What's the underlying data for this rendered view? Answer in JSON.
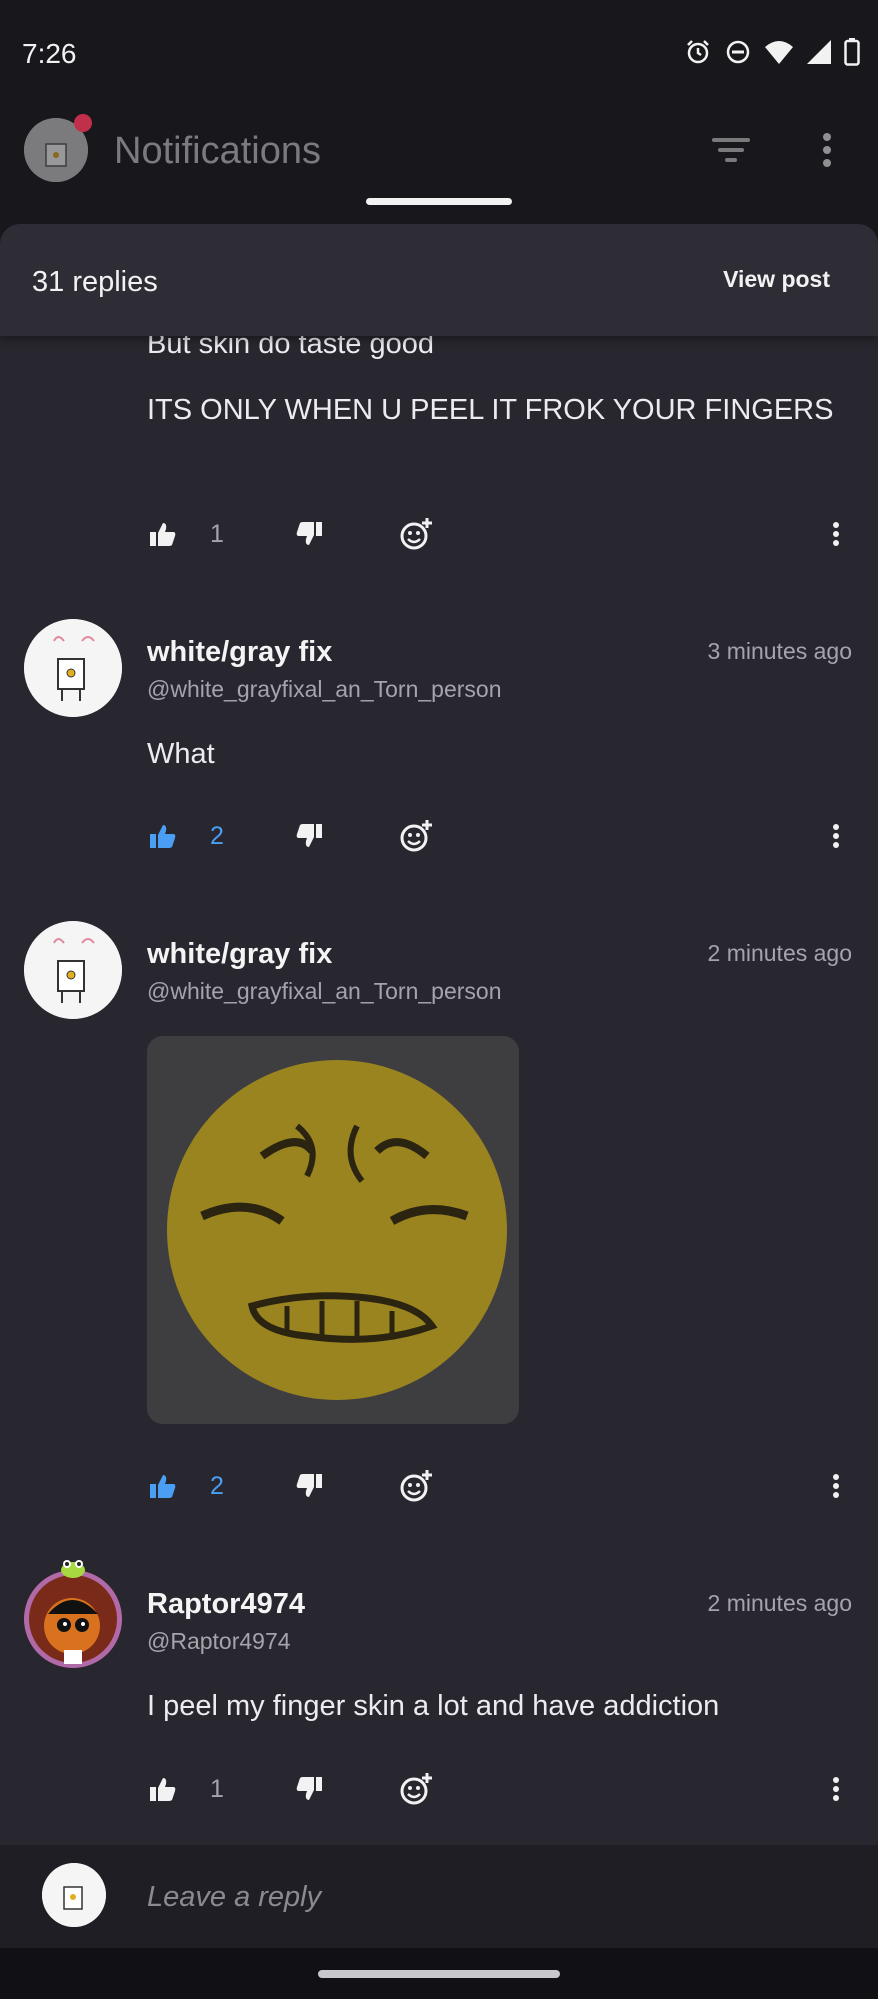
{
  "status_bar": {
    "time": "7:26"
  },
  "header": {
    "title": "Notifications"
  },
  "sheet": {
    "replies_count": "31 replies",
    "view_post": "View post"
  },
  "partial_comment": {
    "line1": "But skin do taste good",
    "line2": "ITS ONLY WHEN U PEEL IT FROK YOUR FINGERS",
    "likes": "1"
  },
  "comments": [
    {
      "username": "white/gray fix",
      "handle": "@white_grayfixal_an_Torn_person",
      "time": "3 minutes ago",
      "text": "What",
      "likes": "2",
      "liked": true
    },
    {
      "username": "white/gray fix",
      "handle": "@white_grayfixal_an_Torn_person",
      "time": "2 minutes ago",
      "text": "",
      "likes": "2",
      "liked": true,
      "has_image": true
    },
    {
      "username": "Raptor4974",
      "handle": "@Raptor4974",
      "time": "2 minutes ago",
      "text": "I peel my finger skin a lot and have addiction",
      "likes": "1",
      "liked": false
    }
  ],
  "reply_input": {
    "placeholder": "Leave a reply"
  },
  "colors": {
    "accent_like": "#4a9ff5",
    "sheet_bg": "#28272f",
    "notification_dot": "#c0304a"
  },
  "icons": [
    "alarm-icon",
    "dnd-icon",
    "wifi-icon",
    "signal-icon",
    "battery-icon",
    "filter-icon",
    "more-vert-icon",
    "thumbs-up-icon",
    "thumbs-down-icon",
    "emoji-add-icon"
  ]
}
